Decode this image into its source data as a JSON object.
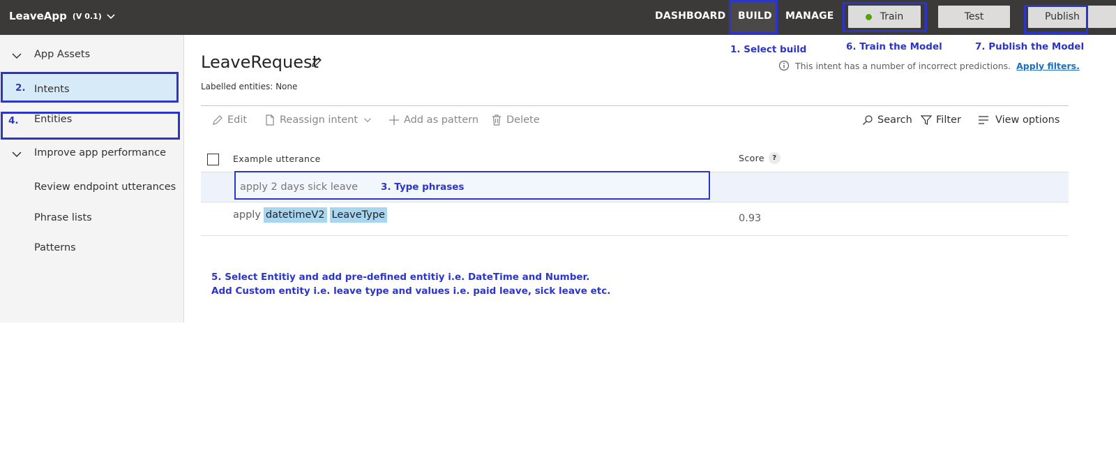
{
  "app": {
    "name": "LeaveApp",
    "version": "(V 0.1)"
  },
  "nav": {
    "dashboard": "DASHBOARD",
    "build": "BUILD",
    "manage": "MANAGE"
  },
  "toolbar_buttons": {
    "train": "Train",
    "test": "Test",
    "publish": "Publish"
  },
  "sidebar": {
    "app_assets": "App Assets",
    "intents": "Intents",
    "entities": "Entities",
    "improve": "Improve app performance",
    "review": "Review endpoint utterances",
    "phrase_lists": "Phrase lists",
    "patterns": "Patterns"
  },
  "intent": {
    "title": "LeaveRequest",
    "labelled_entities": "Labelled entities: None",
    "info_text": "This intent has a number of incorrect predictions.",
    "info_link": "Apply filters."
  },
  "commands": {
    "edit": "Edit",
    "reassign": "Reassign intent",
    "add_pattern": "Add as pattern",
    "delete": "Delete",
    "search": "Search",
    "filter": "Filter",
    "view_options": "View options"
  },
  "table": {
    "col_utterance": "Example utterance",
    "col_score": "Score",
    "score_help": "?",
    "input_value": "apply 2 days sick leave",
    "row2_prefix": "apply",
    "row2_entity1": "datetimeV2",
    "row2_entity2": "LeaveType",
    "row2_score": "0.93"
  },
  "annotations": {
    "step1": "1. Select build",
    "step2": "2.",
    "step3": "3. Type phrases",
    "step4": "4.",
    "step5_line1": "5. Select Entitiy and add pre-defined entitiy i.e. DateTime and Number.",
    "step5_line2": "Add Custom entity i.e. leave type and values i.e. paid leave, sick leave etc.",
    "step6": "6. Train the Model",
    "step7": "7. Publish the Model"
  },
  "colors": {
    "topbar": "#3b3a39",
    "annotation": "#2b36c8",
    "entity_chip": "#a8d6f0",
    "train_dot": "#57a300",
    "link": "#1b6ec2"
  }
}
